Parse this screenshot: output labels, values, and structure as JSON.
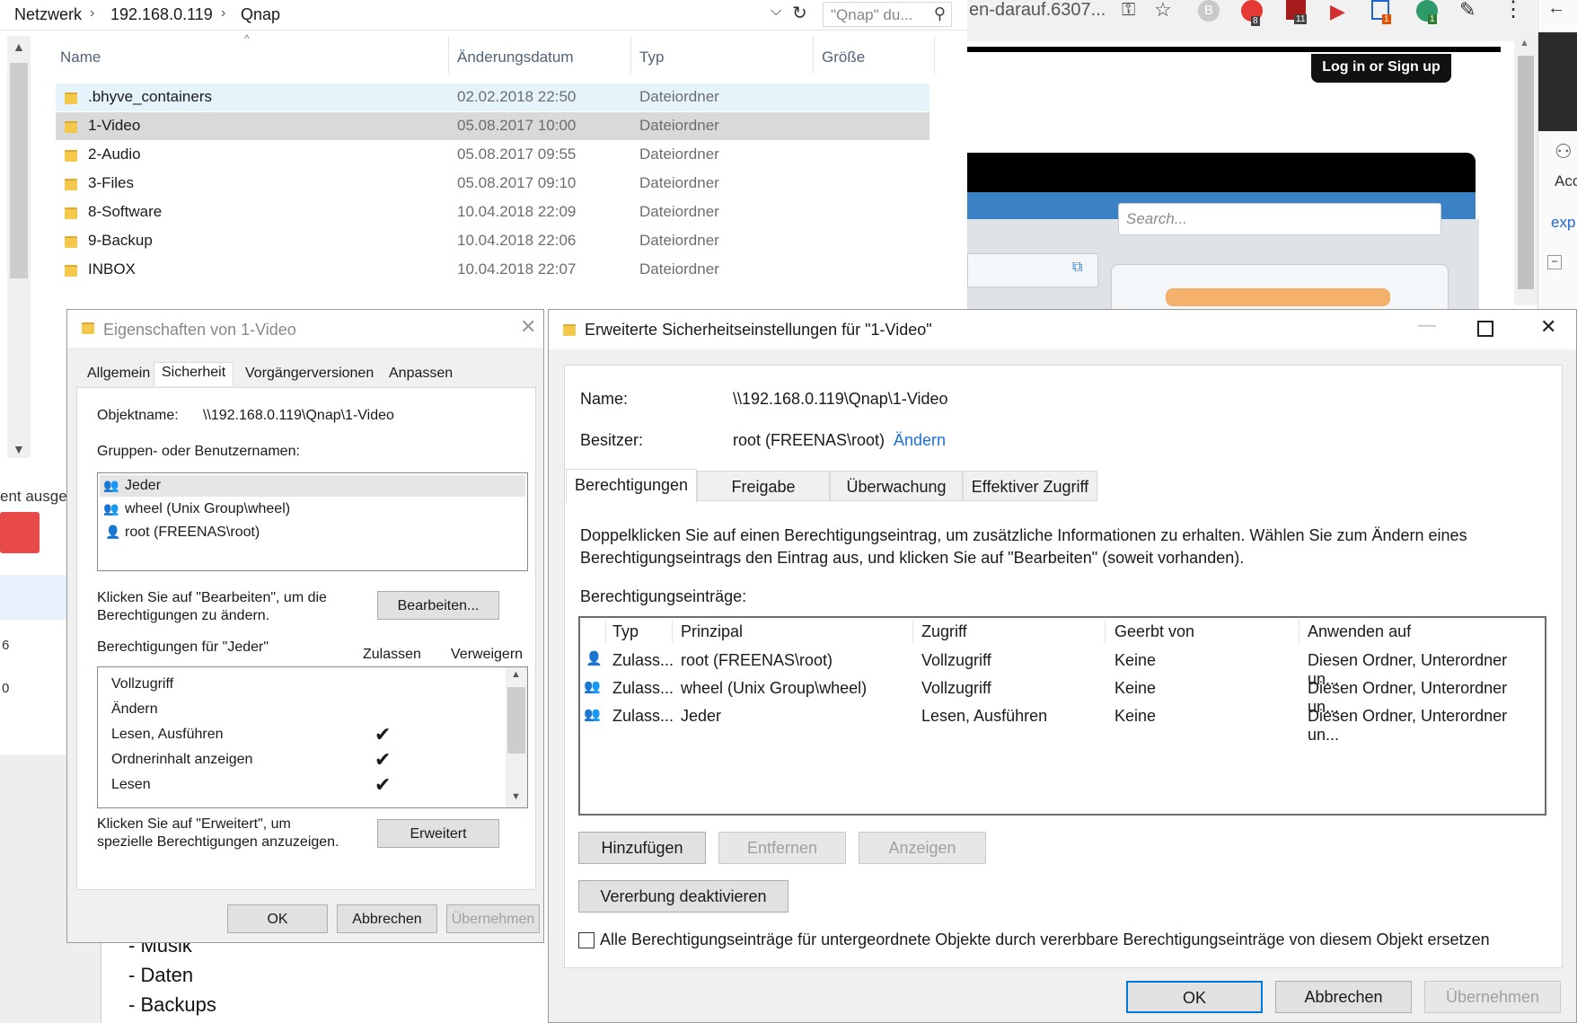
{
  "explorer": {
    "breadcrumb": [
      "Netzwerk",
      "192.168.0.119",
      "Qnap"
    ],
    "search_placeholder": "\"Qnap\" du...",
    "columns": {
      "name": "Name",
      "date": "Änderungsdatum",
      "type": "Typ",
      "size": "Größe"
    },
    "rows": [
      {
        "name": ".bhyve_containers",
        "date": "02.02.2018 22:50",
        "type": "Dateiordner"
      },
      {
        "name": "1-Video",
        "date": "05.08.2017 10:00",
        "type": "Dateiordner"
      },
      {
        "name": "2-Audio",
        "date": "05.08.2017 09:55",
        "type": "Dateiordner"
      },
      {
        "name": "3-Files",
        "date": "05.08.2017 09:10",
        "type": "Dateiordner"
      },
      {
        "name": "8-Software",
        "date": "10.04.2018 22:09",
        "type": "Dateiordner"
      },
      {
        "name": "9-Backup",
        "date": "10.04.2018 22:06",
        "type": "Dateiordner"
      },
      {
        "name": "INBOX",
        "date": "10.04.2018 22:07",
        "type": "Dateiordner"
      }
    ],
    "side_fragment": "ent ausge",
    "side_numbers": [
      "6",
      "0"
    ]
  },
  "browser": {
    "url_fragment": "en-darauf.6307...",
    "login_button": "Log in or Sign up",
    "search_placeholder": "Search...",
    "badges": [
      "8",
      "11",
      "1",
      "1"
    ],
    "right_fragments": [
      "Acc",
      "exp"
    ]
  },
  "background_page": {
    "list": [
      "- Musik",
      "- Daten",
      "- Backups"
    ]
  },
  "props": {
    "title": "Eigenschaften von 1-Video",
    "tabs": [
      "Allgemein",
      "Sicherheit",
      "Vorgängerversionen",
      "Anpassen"
    ],
    "object_label": "Objektname:",
    "object_value": "\\\\192.168.0.119\\Qnap\\1-Video",
    "groups_label": "Gruppen- oder Benutzernamen:",
    "groups": [
      "Jeder",
      "wheel (Unix Group\\wheel)",
      "root (FREENAS\\root)"
    ],
    "edit_hint": "Klicken Sie auf \"Bearbeiten\", um die Berechtigungen zu ändern.",
    "edit_button": "Bearbeiten...",
    "perm_for": "Berechtigungen für \"Jeder\"",
    "allow": "Zulassen",
    "deny": "Verweigern",
    "permissions": [
      {
        "name": "Vollzugriff",
        "allow": ""
      },
      {
        "name": "Ändern",
        "allow": ""
      },
      {
        "name": "Lesen, Ausführen",
        "allow": "✔"
      },
      {
        "name": "Ordnerinhalt anzeigen",
        "allow": "✔"
      },
      {
        "name": "Lesen",
        "allow": "✔"
      }
    ],
    "advanced_hint": "Klicken Sie auf \"Erweitert\", um spezielle Berechtigungen anzuzeigen.",
    "advanced_button": "Erweitert",
    "ok": "OK",
    "cancel": "Abbrechen",
    "apply": "Übernehmen"
  },
  "adv": {
    "title": "Erweiterte Sicherheitseinstellungen für \"1-Video\"",
    "name_label": "Name:",
    "name_value": "\\\\192.168.0.119\\Qnap\\1-Video",
    "owner_label": "Besitzer:",
    "owner_value": "root (FREENAS\\root)",
    "owner_change": "Ändern",
    "tabs": [
      "Berechtigungen",
      "Freigabe",
      "Überwachung",
      "Effektiver Zugriff"
    ],
    "info": "Doppelklicken Sie auf einen Berechtigungseintrag, um zusätzliche Informationen zu erhalten. Wählen Sie zum Ändern eines Berechtigungseintrags den Eintrag aus, und klicken Sie auf \"Bearbeiten\" (soweit vorhanden).",
    "entries_label": "Berechtigungseinträge:",
    "columns": {
      "type": "Typ",
      "principal": "Prinzipal",
      "access": "Zugriff",
      "inherited": "Geerbt von",
      "applies": "Anwenden auf"
    },
    "entries": [
      {
        "type": "Zulass...",
        "principal": "root (FREENAS\\root)",
        "access": "Vollzugriff",
        "inherited": "Keine",
        "applies": "Diesen Ordner, Unterordner un..."
      },
      {
        "type": "Zulass...",
        "principal": "wheel (Unix Group\\wheel)",
        "access": "Vollzugriff",
        "inherited": "Keine",
        "applies": "Diesen Ordner, Unterordner un..."
      },
      {
        "type": "Zulass...",
        "principal": "Jeder",
        "access": "Lesen, Ausführen",
        "inherited": "Keine",
        "applies": "Diesen Ordner, Unterordner un..."
      }
    ],
    "add": "Hinzufügen",
    "remove": "Entfernen",
    "view": "Anzeigen",
    "disable_inheritance": "Vererbung deaktivieren",
    "replace_checkbox": "Alle Berechtigungseinträge für untergeordnete Objekte durch vererbbare Berechtigungseinträge von diesem Objekt ersetzen",
    "ok": "OK",
    "cancel": "Abbrechen",
    "apply": "Übernehmen"
  }
}
